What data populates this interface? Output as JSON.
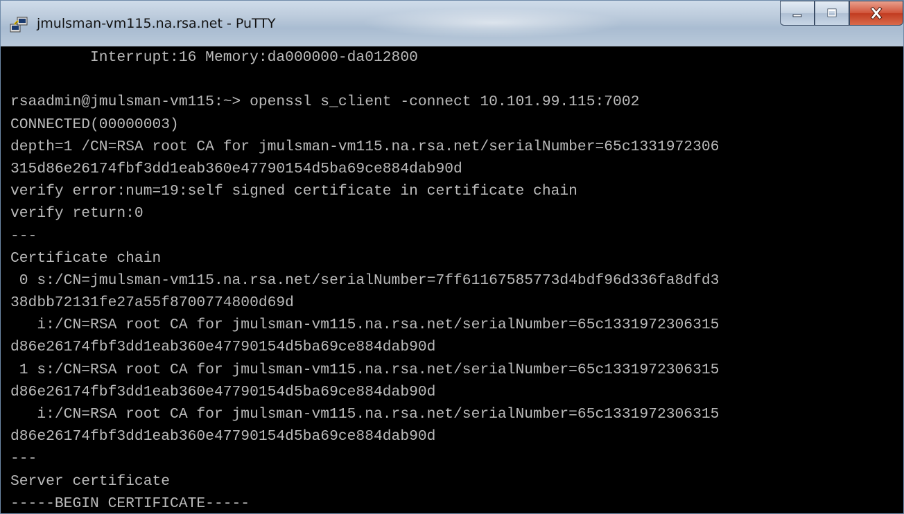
{
  "window": {
    "title": "jmulsman-vm115.na.rsa.net - PuTTY",
    "icon": "putty-icon",
    "controls": [
      "minimize-icon",
      "maximize-icon",
      "close-icon"
    ]
  },
  "terminal": {
    "lines": [
      "         Interrupt:16 Memory:da000000-da012800",
      "",
      "rsaadmin@jmulsman-vm115:~> openssl s_client -connect 10.101.99.115:7002",
      "CONNECTED(00000003)",
      "depth=1 /CN=RSA root CA for jmulsman-vm115.na.rsa.net/serialNumber=65c1331972306",
      "315d86e26174fbf3dd1eab360e47790154d5ba69ce884dab90d",
      "verify error:num=19:self signed certificate in certificate chain",
      "verify return:0",
      "---",
      "Certificate chain",
      " 0 s:/CN=jmulsman-vm115.na.rsa.net/serialNumber=7ff61167585773d4bdf96d336fa8dfd3",
      "38dbb72131fe27a55f8700774800d69d",
      "   i:/CN=RSA root CA for jmulsman-vm115.na.rsa.net/serialNumber=65c1331972306315",
      "d86e26174fbf3dd1eab360e47790154d5ba69ce884dab90d",
      " 1 s:/CN=RSA root CA for jmulsman-vm115.na.rsa.net/serialNumber=65c1331972306315",
      "d86e26174fbf3dd1eab360e47790154d5ba69ce884dab90d",
      "   i:/CN=RSA root CA for jmulsman-vm115.na.rsa.net/serialNumber=65c1331972306315",
      "d86e26174fbf3dd1eab360e47790154d5ba69ce884dab90d",
      "---",
      "Server certificate",
      "-----BEGIN CERTIFICATE-----"
    ]
  },
  "colors": {
    "terminal_bg": "#000000",
    "terminal_fg": "#bbbbbb"
  }
}
